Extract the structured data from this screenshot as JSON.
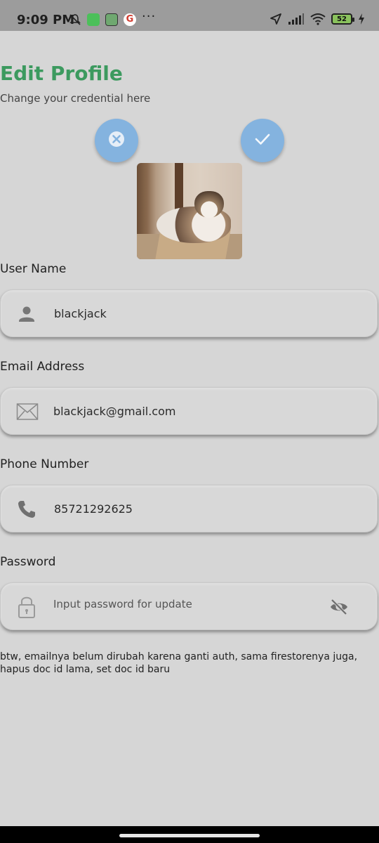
{
  "status_bar": {
    "time": "9:09 PM",
    "left_icons": [
      "mute-icon",
      "app-icon",
      "app-icon",
      "google-icon",
      "more-dots-icon"
    ],
    "right_icons": [
      "location-icon",
      "signal-icon",
      "wifi-icon",
      "battery-icon",
      "charging-icon"
    ],
    "battery_level": "52"
  },
  "header": {
    "title": "Edit Profile",
    "subtitle": "Change your credential here"
  },
  "actions": {
    "cancel_icon": "close-circle-icon",
    "confirm_icon": "check-icon"
  },
  "profile_photo": {
    "description_icon": "cat-photo"
  },
  "fields": {
    "username": {
      "label": "User Name",
      "value": "blackjack",
      "icon": "person-icon"
    },
    "email": {
      "label": "Email Address",
      "value": "blackjack@gmail.com",
      "icon": "mail-icon"
    },
    "phone": {
      "label": "Phone Number",
      "value": "85721292625",
      "icon": "phone-icon"
    },
    "password": {
      "label": "Password",
      "placeholder": "Input password for update",
      "icon": "lock-icon",
      "toggle_icon": "eye-off-icon"
    }
  },
  "note": "btw, emailnya belum dirubah karena ganti auth, sama firestorenya juga, hapus doc id lama, set doc id baru",
  "colors": {
    "accent": "#3c9a5f",
    "action_button": "#84b3df",
    "background": "#d6d6d6"
  }
}
